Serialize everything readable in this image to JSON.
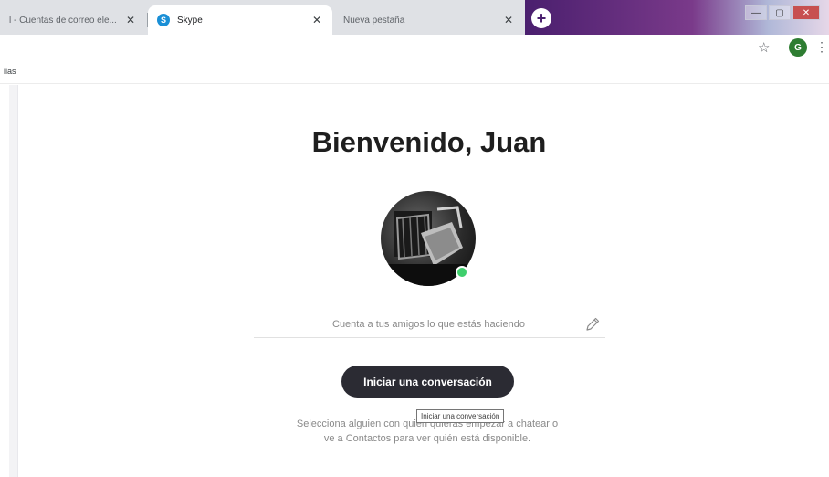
{
  "browser": {
    "tabs": [
      {
        "label": "l - Cuentas de correo ele...",
        "close": "✕"
      },
      {
        "label": "Skype",
        "favicon": "S",
        "close": "✕"
      },
      {
        "label": "Nueva pestaña",
        "close": "✕"
      }
    ],
    "new_tab_symbol": "+",
    "window_controls": {
      "minimize": "—",
      "maximize": "▢",
      "close": "✕"
    },
    "profile_initial": "G",
    "star_symbol": "☆",
    "menu_symbol": "⋮",
    "bookmarks": {
      "item": "ilas"
    }
  },
  "skype": {
    "welcome_title": "Bienvenido, Juan",
    "mood_placeholder": "Cuenta a tus amigos lo que estás haciendo",
    "start_button_label": "Iniciar una conversación",
    "tooltip": "Iniciar una conversación",
    "help_text": "Selecciona alguien con quien quieras empezar a chatear o ve a Contactos para ver quién está disponible.",
    "presence_color": "#3fcf6d",
    "button_color": "#2b2b33"
  }
}
